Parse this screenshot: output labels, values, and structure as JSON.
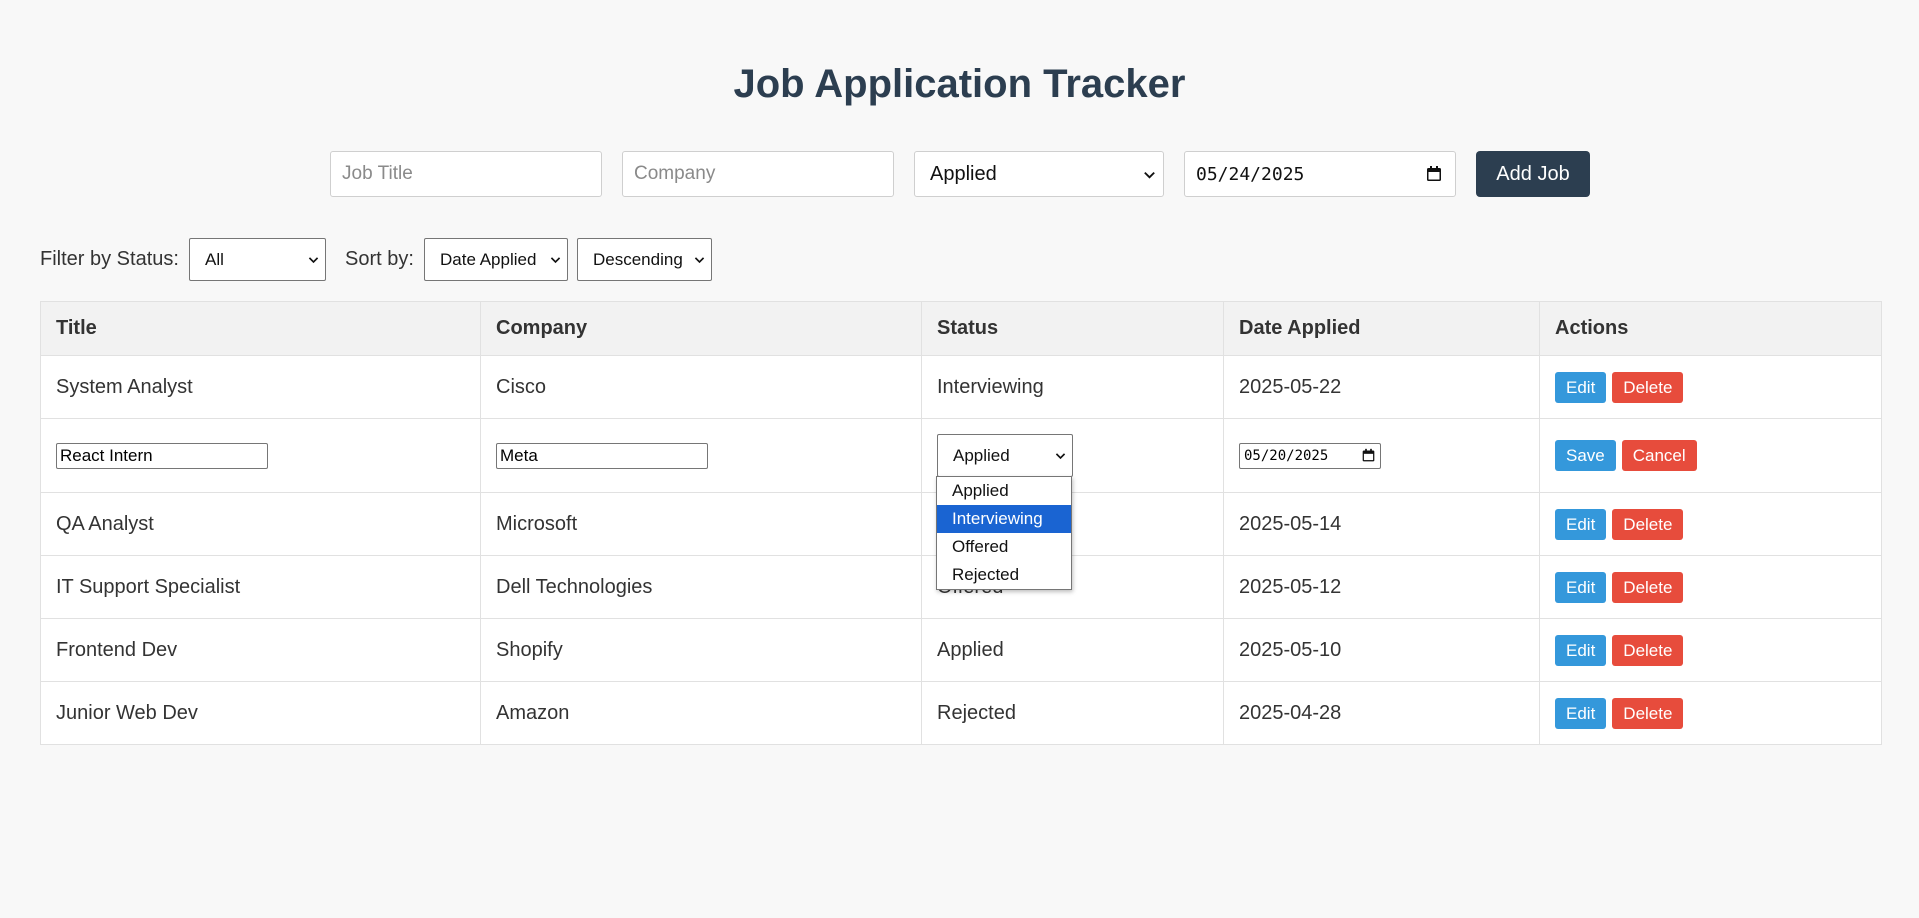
{
  "title": "Job Application Tracker",
  "add_form": {
    "title_placeholder": "Job Title",
    "company_placeholder": "Company",
    "status_selected": "Applied",
    "date_value": "05/24/2025",
    "add_button": "Add Job"
  },
  "controls": {
    "filter_label": "Filter by Status:",
    "filter_value": "All",
    "sort_label": "Sort by:",
    "sort_field": "Date Applied",
    "sort_order": "Descending"
  },
  "table": {
    "headers": [
      "Title",
      "Company",
      "Status",
      "Date Applied",
      "Actions"
    ],
    "actions": {
      "edit": "Edit",
      "delete": "Delete",
      "save": "Save",
      "cancel": "Cancel"
    },
    "rows": [
      {
        "title": "System Analyst",
        "company": "Cisco",
        "status": "Interviewing",
        "date": "2025-05-22"
      },
      {
        "title": "React Intern",
        "company": "Meta",
        "status": "Applied",
        "date": "05/20/2025"
      },
      {
        "title": "QA Analyst",
        "company": "Microsoft",
        "status": "",
        "date": "2025-05-14"
      },
      {
        "title": "IT Support Specialist",
        "company": "Dell Technologies",
        "status": "Offered",
        "date": "2025-05-12"
      },
      {
        "title": "Frontend Dev",
        "company": "Shopify",
        "status": "Applied",
        "date": "2025-05-10"
      },
      {
        "title": "Junior Web Dev",
        "company": "Amazon",
        "status": "Rejected",
        "date": "2025-04-28"
      }
    ]
  },
  "status_dropdown": {
    "options": [
      "Applied",
      "Interviewing",
      "Offered",
      "Rejected"
    ],
    "highlighted": "Interviewing"
  },
  "colors": {
    "title": "#2c3e50",
    "add_button": "#2c3e50",
    "edit_button": "#3498db",
    "delete_button": "#e74c3c",
    "dropdown_highlight": "#1a64d2"
  },
  "icons": {
    "select_arrow": "chevron-down-icon",
    "date_picker": "calendar-icon"
  }
}
